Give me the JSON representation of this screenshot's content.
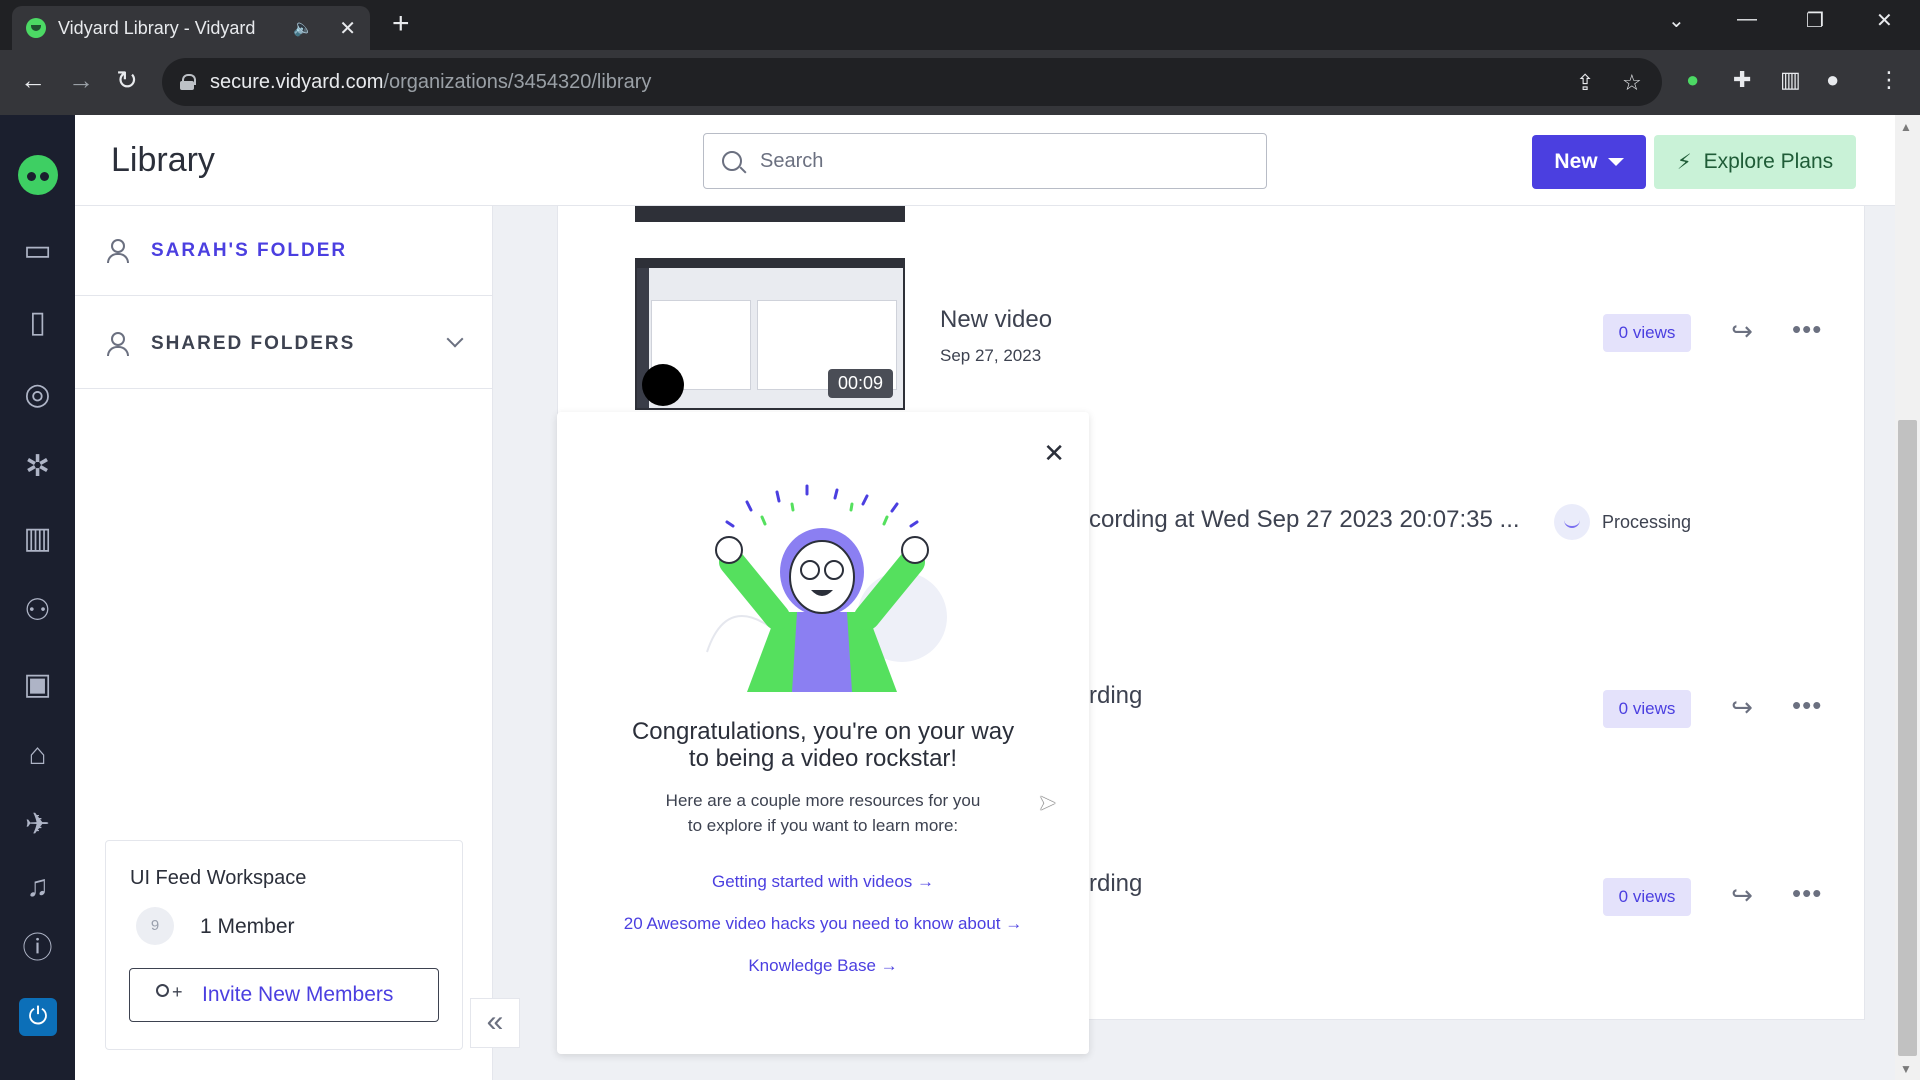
{
  "browser": {
    "tab_title": "Vidyard Library - Vidyard",
    "audio_glyph": "🔈",
    "close_glyph": "✕",
    "new_tab_glyph": "+",
    "url_host": "secure.vidyard.com",
    "url_path": "/organizations/3454320/library",
    "controls": {
      "dropdown": "⌄",
      "minimize": "—",
      "restore": "❐",
      "close": "✕"
    },
    "nav": {
      "back": "←",
      "forward": "→",
      "reload": "↻"
    }
  },
  "app": {
    "page_title": "Library",
    "search_placeholder": "Search",
    "new_label": "New",
    "explore_label": "Explore Plans",
    "explore_icon": "⚡",
    "rail_icons": [
      "video-icon",
      "door-icon",
      "target-icon",
      "network-icon",
      "chart-icon",
      "people-icon",
      "playlist-icon",
      "graduation-icon",
      "telescope-icon",
      "bell-icon",
      "help-icon",
      "power-icon"
    ]
  },
  "sidebar": {
    "my_folder": "SARAH'S FOLDER",
    "shared_folders": "SHARED FOLDERS",
    "workspace_name": "UI Feed Workspace",
    "workspace_avatar": "9",
    "member_count": "1 Member",
    "invite_label": "Invite New Members",
    "collapse_glyph": "«"
  },
  "videos": [
    {
      "title": "New video",
      "date": "Sep 27, 2023",
      "duration": "00:09",
      "views": "0 views"
    },
    {
      "title": "cording at Wed Sep 27 2023 20:07:35 ...",
      "status": "Processing"
    },
    {
      "title": "rding",
      "views": "0 views"
    },
    {
      "title": "rding",
      "views": "0 views"
    }
  ],
  "actions": {
    "share_glyph": "↪",
    "more_glyph": "•••"
  },
  "popup": {
    "close_glyph": "✕",
    "heading_line1": "Congratulations, you're on your way",
    "heading_line2": "to being a video rockstar!",
    "sub_line1": "Here are a couple more resources for you",
    "sub_line2": "to explore if you want to learn more:",
    "link1": "Getting started with videos →",
    "link2": "20 Awesome video hacks you need to know about →",
    "link3": "Knowledge Base →"
  }
}
